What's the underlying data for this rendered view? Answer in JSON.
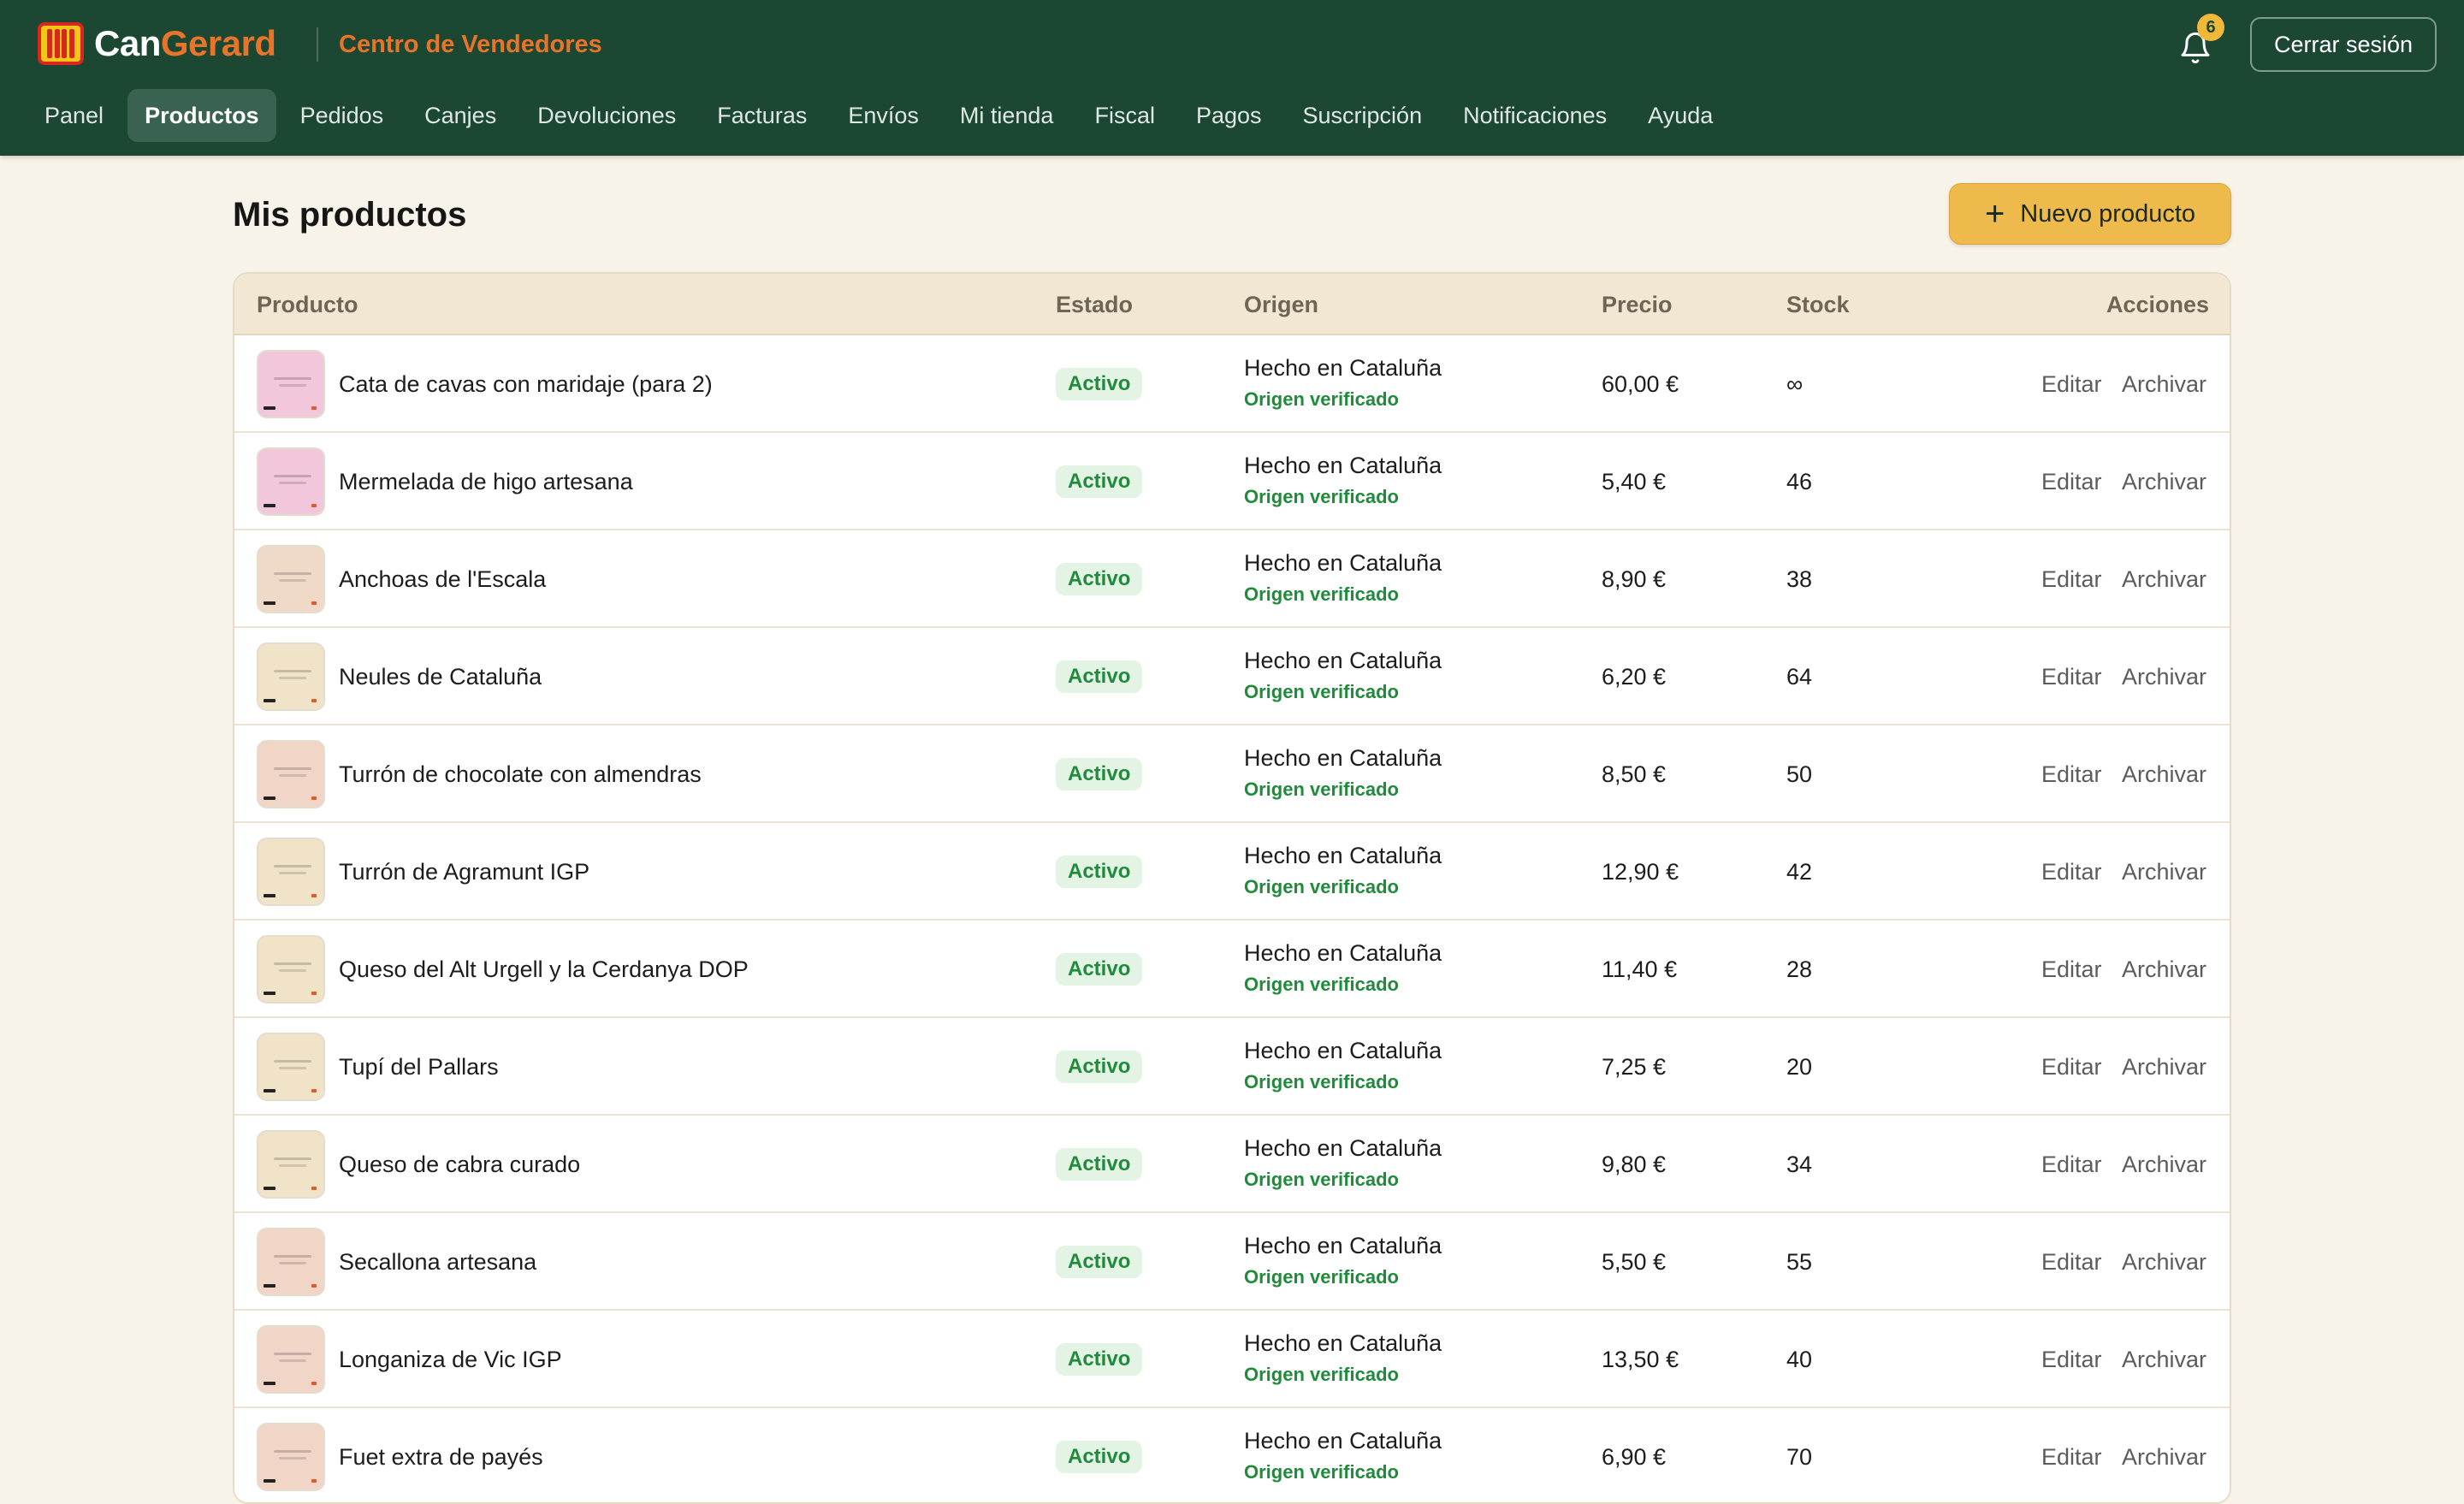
{
  "colors": {
    "header_bg": "#1b4733",
    "brand_orange": "#e8742a",
    "accent_button": "#eeba4b",
    "status_green": "#1f8b3b",
    "page_bg": "#f8f3e8"
  },
  "header": {
    "brand_part1": "Can",
    "brand_part2": "Gerard",
    "subtitle": "Centro de Vendedores",
    "notification_count": "6",
    "logout_label": "Cerrar sesión",
    "icons": {
      "logo": "senyera-logo-icon",
      "bell": "bell-icon"
    }
  },
  "nav": {
    "items": [
      {
        "label": "Panel"
      },
      {
        "label": "Productos",
        "active": true
      },
      {
        "label": "Pedidos"
      },
      {
        "label": "Canjes"
      },
      {
        "label": "Devoluciones"
      },
      {
        "label": "Facturas"
      },
      {
        "label": "Envíos"
      },
      {
        "label": "Mi tienda"
      },
      {
        "label": "Fiscal"
      },
      {
        "label": "Pagos"
      },
      {
        "label": "Suscripción"
      },
      {
        "label": "Notificaciones"
      },
      {
        "label": "Ayuda"
      }
    ]
  },
  "main": {
    "title": "Mis productos",
    "new_product_label": "Nuevo producto",
    "new_product_icon": "plus-icon"
  },
  "table": {
    "headers": {
      "product": "Producto",
      "status": "Estado",
      "origin": "Origen",
      "price": "Precio",
      "stock": "Stock",
      "actions": "Acciones"
    },
    "edit_label": "Editar",
    "archive_label": "Archivar",
    "rows": [
      {
        "name": "Cata de cavas con maridaje (para 2)",
        "status": "Activo",
        "origin": "Hecho en Cataluña",
        "verified": "Origen verificado",
        "price": "60,00 €",
        "stock": "∞",
        "thumb": "#f2c7dc"
      },
      {
        "name": "Mermelada de higo artesana",
        "status": "Activo",
        "origin": "Hecho en Cataluña",
        "verified": "Origen verificado",
        "price": "5,40 €",
        "stock": "46",
        "thumb": "#f2c7dc"
      },
      {
        "name": "Anchoas de l'Escala",
        "status": "Activo",
        "origin": "Hecho en Cataluña",
        "verified": "Origen verificado",
        "price": "8,90 €",
        "stock": "38",
        "thumb": "#f1d9c8"
      },
      {
        "name": "Neules de Cataluña",
        "status": "Activo",
        "origin": "Hecho en Cataluña",
        "verified": "Origen verificado",
        "price": "6,20 €",
        "stock": "64",
        "thumb": "#f1e3c8"
      },
      {
        "name": "Turrón de chocolate con almendras",
        "status": "Activo",
        "origin": "Hecho en Cataluña",
        "verified": "Origen verificado",
        "price": "8,50 €",
        "stock": "50",
        "thumb": "#f1d6c8"
      },
      {
        "name": "Turrón de Agramunt IGP",
        "status": "Activo",
        "origin": "Hecho en Cataluña",
        "verified": "Origen verificado",
        "price": "12,90 €",
        "stock": "42",
        "thumb": "#f1e3c8"
      },
      {
        "name": "Queso del Alt Urgell y la Cerdanya DOP",
        "status": "Activo",
        "origin": "Hecho en Cataluña",
        "verified": "Origen verificado",
        "price": "11,40 €",
        "stock": "28",
        "thumb": "#f1e3c8"
      },
      {
        "name": "Tupí del Pallars",
        "status": "Activo",
        "origin": "Hecho en Cataluña",
        "verified": "Origen verificado",
        "price": "7,25 €",
        "stock": "20",
        "thumb": "#f1e3c8"
      },
      {
        "name": "Queso de cabra curado",
        "status": "Activo",
        "origin": "Hecho en Cataluña",
        "verified": "Origen verificado",
        "price": "9,80 €",
        "stock": "34",
        "thumb": "#f1e3c8"
      },
      {
        "name": "Secallona artesana",
        "status": "Activo",
        "origin": "Hecho en Cataluña",
        "verified": "Origen verificado",
        "price": "5,50 €",
        "stock": "55",
        "thumb": "#f1d6c8"
      },
      {
        "name": "Longaniza de Vic IGP",
        "status": "Activo",
        "origin": "Hecho en Cataluña",
        "verified": "Origen verificado",
        "price": "13,50 €",
        "stock": "40",
        "thumb": "#f1d6c8"
      },
      {
        "name": "Fuet extra de payés",
        "status": "Activo",
        "origin": "Hecho en Cataluña",
        "verified": "Origen verificado",
        "price": "6,90 €",
        "stock": "70",
        "thumb": "#f1d6c8"
      }
    ]
  }
}
